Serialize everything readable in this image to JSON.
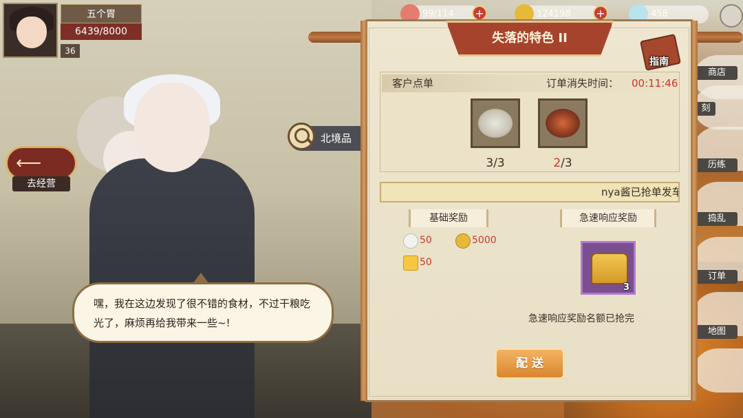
{
  "player": {
    "name": "五个胃",
    "hp": "6439/8000",
    "level": "36"
  },
  "resources": {
    "stamina": "99/114",
    "gold": "124198",
    "gems": "458",
    "plus": "+"
  },
  "nav": {
    "back_label": "去经营",
    "back_arrow": "⟵",
    "search_text": "北境品"
  },
  "side_menu": [
    "商店",
    "刻",
    "历练",
    "捣乱",
    "订单",
    "地图"
  ],
  "dialog": {
    "title": "失落的特色 II",
    "guide_label": "指南",
    "order_title": "客户点单",
    "timer_label": "订单消失时间：",
    "timer_value": "00:11:46",
    "dishes": [
      {
        "icon": "fish-dish-icon",
        "done": "3",
        "total": "/3"
      },
      {
        "icon": "shrimp-dish-icon",
        "done": "2",
        "total": "/3"
      }
    ],
    "marquee": "nya酱已抢单发车",
    "basic_reward_tab": "基础奖励",
    "rapid_reward_tab": "急速响应奖励",
    "basic_rewards": [
      {
        "icon": "chef-hat-icon",
        "value": "50"
      },
      {
        "icon": "gold-coin-icon",
        "value": "5000"
      },
      {
        "icon": "crown-icon",
        "value": "50"
      }
    ],
    "rapid_reward": {
      "icon": "treasure-chest-icon",
      "count": "3"
    },
    "rapid_note": "急速响应奖励名额已抢完",
    "deliver_button": "配 送"
  },
  "speech": {
    "text": "嘿，我在这边发现了很不错的食材，不过干粮吃光了，麻烦再给我带来一些~!"
  }
}
